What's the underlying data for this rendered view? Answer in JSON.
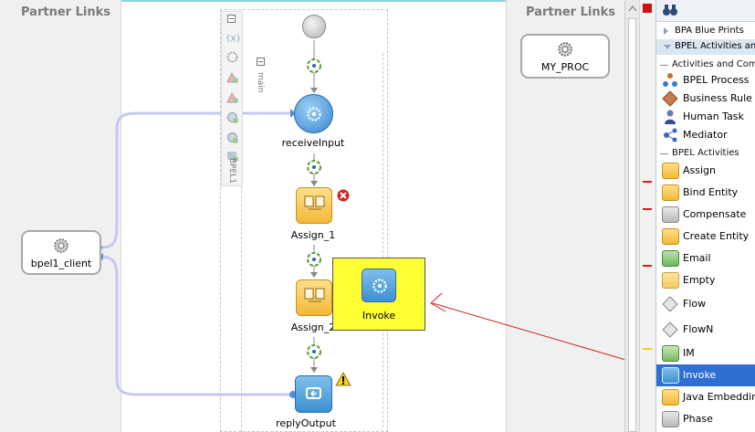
{
  "canvas": {
    "left_lane_title": "Partner Links",
    "right_lane_title": "Partner Links",
    "left_partner": "bpel1_client",
    "right_partner": "MY_PROC",
    "scope_label": "main",
    "process_label": "BPEL1",
    "nodes": {
      "receive": "receiveInput",
      "assign1": "Assign_1",
      "assign2": "Assign_2",
      "reply": "replyOutput"
    },
    "drop_target_label": "Invoke"
  },
  "palette": {
    "blueprints": "BPA Blue Prints",
    "bpel_activities_components": "BPEL Activities and Components",
    "group_activities_components": "Activities and Components",
    "components": [
      {
        "label": "BPEL Process",
        "icon": "bpel-process-icon"
      },
      {
        "label": "Business Rule",
        "icon": "business-rule-icon"
      },
      {
        "label": "Human Task",
        "icon": "human-task-icon"
      },
      {
        "label": "Mediator",
        "icon": "mediator-icon"
      }
    ],
    "group_bpel_activities": "BPEL Activities",
    "activities": [
      {
        "label": "Assign",
        "icon": "assign-icon"
      },
      {
        "label": "Bind Entity",
        "icon": "bind-entity-icon"
      },
      {
        "label": "Compensate",
        "icon": "compensate-icon"
      },
      {
        "label": "Create Entity",
        "icon": "create-entity-icon"
      },
      {
        "label": "Email",
        "icon": "email-icon"
      },
      {
        "label": "Empty",
        "icon": "empty-icon"
      },
      {
        "label": "Flow",
        "icon": "flow-icon"
      },
      {
        "label": "FlowN",
        "icon": "flown-icon"
      },
      {
        "label": "IM",
        "icon": "im-icon"
      },
      {
        "label": "Invoke",
        "icon": "invoke-icon"
      },
      {
        "label": "Java Embedding",
        "icon": "java-embedding-icon"
      },
      {
        "label": "Phase",
        "icon": "phase-icon"
      }
    ],
    "selected": "Invoke"
  },
  "colors": {
    "drop_highlight": "#ffff33",
    "selection": "#2e6fd1",
    "error_marker": "#cc0000",
    "link_line": "#b9c0ef",
    "drag_arrow": "#cc2020"
  }
}
